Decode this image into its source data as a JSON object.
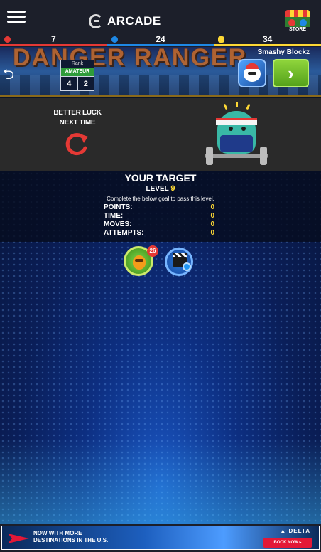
{
  "header": {
    "menu_icon": "hamburger-menu-icon",
    "brand": "ARCADE",
    "store_label": "STORE"
  },
  "stats": [
    {
      "icon": "red-ticket-icon",
      "value": "7",
      "color": "#e53935"
    },
    {
      "icon": "blue-gem-icon",
      "value": "24",
      "color": "#1e88e5"
    },
    {
      "icon": "gold-coin-icon",
      "value": "34",
      "color": "#fdd835"
    }
  ],
  "banner": {
    "game_title": "DANGER RANGER",
    "rank_label": "Rank",
    "rank_tier": "AMATEUR",
    "rank_values": [
      "4",
      "2"
    ],
    "next_game_name": "Smashy Blockz"
  },
  "result": {
    "message_line1": "BETTER LUCK",
    "message_line2": "NEXT TIME"
  },
  "target": {
    "heading": "YOUR TARGET",
    "level_label": "LEVEL",
    "level_value": "9",
    "description": "Complete the below goal to pass this level.",
    "goals": [
      {
        "label": "POINTS:",
        "value": "0"
      },
      {
        "label": "TIME:",
        "value": "0"
      },
      {
        "label": "MOVES:",
        "value": "0"
      },
      {
        "label": "ATTEMPTS:",
        "value": "0"
      }
    ]
  },
  "boosters": {
    "character_count": "26"
  },
  "ad": {
    "line1": "NOW WITH MORE",
    "line2": "DESTINATIONS IN THE U.S.",
    "brand": "▲ DELTA",
    "cta": "BOOK NOW ▸"
  }
}
